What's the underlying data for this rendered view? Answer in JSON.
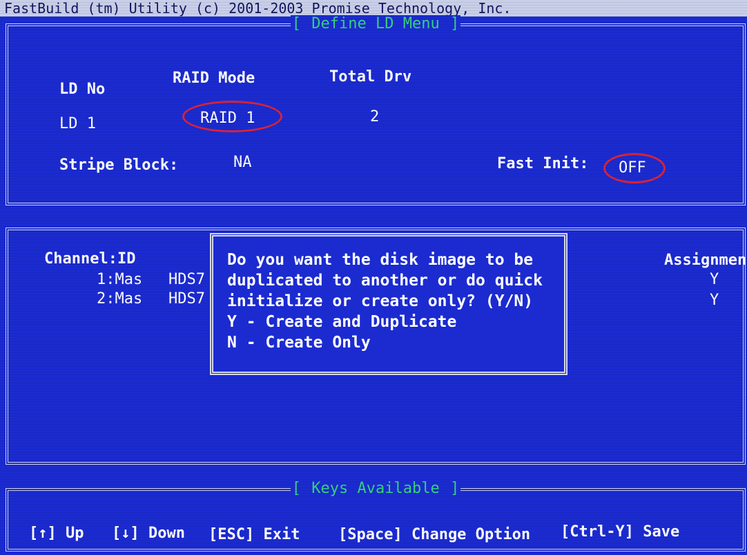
{
  "title_bar": "FastBuild (tm) Utility (c) 2001-2003 Promise Technology, Inc.",
  "define_panel": {
    "title": "Define LD Menu",
    "col_ld_no": "LD No",
    "col_raid_mode": "RAID Mode",
    "col_total_drv": "Total Drv",
    "row_ld": "LD  1",
    "row_raid_mode": "RAID 1",
    "row_total_drv": "2",
    "stripe_label": "Stripe Block:",
    "stripe_value": "NA",
    "fast_init_label": "Fast Init:",
    "fast_init_value": "OFF"
  },
  "channel_panel": {
    "header_channel": "Channel:ID",
    "header_assignment": "Assignment",
    "rows": [
      {
        "channel": "1:Mas",
        "drive": "HDS7",
        "assignment": "Y"
      },
      {
        "channel": "2:Mas",
        "drive": "HDS7",
        "assignment": "Y"
      }
    ]
  },
  "dialog": {
    "lines": [
      "Do you want the disk image to be",
      "duplicated to another or do quick",
      "initialize or create only? (Y/N)",
      "Y - Create and Duplicate",
      "N - Create Only"
    ]
  },
  "keys_panel": {
    "title": "Keys Available",
    "up": "[↑] Up",
    "down": "[↓] Down",
    "esc": "[ESC] Exit",
    "space": "[Space] Change Option",
    "save": "[Ctrl-Y] Save"
  },
  "colors": {
    "background": "#1b2bd0",
    "text": "#ffffff",
    "title_accent": "#38d27e",
    "annotation_circle": "#d8243a",
    "border": "#d5d9ec"
  }
}
